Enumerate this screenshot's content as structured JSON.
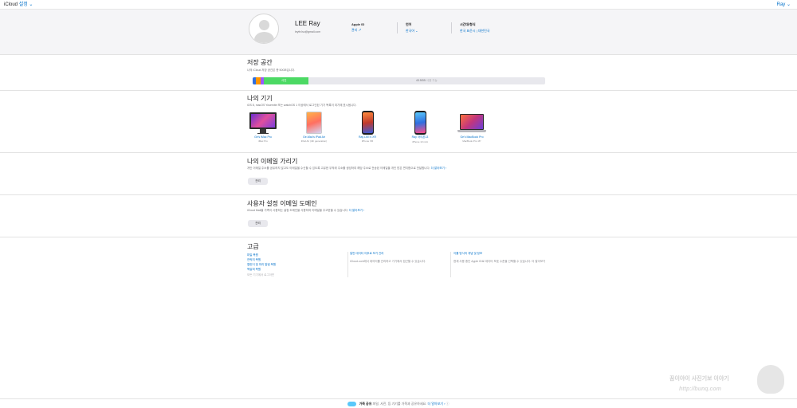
{
  "topbar": {
    "brand": "iCloud",
    "app_title": "설정",
    "user_menu": "Ray"
  },
  "profile": {
    "name": "LEE Ray",
    "email": "leyfe.lsc@gmail.com",
    "apple_id_label": "Apple ID",
    "apple_id_link": "관리",
    "language_label": "언어",
    "language_value": "한국어",
    "timezone_label": "시간대/형식",
    "timezone_value": "한국 표준시 | 대한민국"
  },
  "storage": {
    "title": "저장 공간",
    "subtitle": "나의 iCloud 저장 공간은 총 50GB입니다.",
    "photos_label": "사진",
    "free_label": "43.5GB",
    "free_suffix": "사용 가능",
    "usage": {
      "used_fraction": 0.19
    },
    "colors": {
      "segment1": "#2f6fe0",
      "segment2": "#ff9500",
      "segment3": "#9b59ff",
      "photos": "#4cd964",
      "free": "#e8e8ed"
    }
  },
  "devices": {
    "title": "나의 기기",
    "subtitle": "iOS 8, macOS Yosemite 또는 watchOS 1 이상에서 로그인된 기기 목록이 여기에 표시됩니다.",
    "items": [
      {
        "name": "Ge's iMac Pro",
        "model": "iMac Pro",
        "icon": "imac-icon"
      },
      {
        "name": "Ge-Mac's iPad Air",
        "model": "iPad Air (4th generation)",
        "icon": "ipad-icon"
      },
      {
        "name": "Ray LEE's XR",
        "model": "iPhone XR",
        "icon": "iphone-icon"
      },
      {
        "name": "Ray 아이폰13",
        "model": "iPhone 13 mini",
        "icon": "iphone-icon"
      },
      {
        "name": "Ge's MacBook Pro",
        "model": "MacBook Pro 16\"",
        "icon": "macbook-icon"
      }
    ]
  },
  "hide_email": {
    "title": "나의 이메일 가리기",
    "subtitle": "개인 이메일 주소를 공유하지 않고도 이메일을 수신할 수 있도록 고유한 무작위 주소를 생성하여 해당 주소로 전송된 이메일을 개인 받은 편지함으로 전달합니다.",
    "more_link": "더 알아보기 ›",
    "button": "관리"
  },
  "custom_domain": {
    "title": "사용자 설정 이메일 도메인",
    "subtitle": "iCloud Mail을 가족이 사용하는 설정 도메인을 사용하여 이메일을 주고받을 수 있습니다.",
    "more_link": "더 알아보기 ›",
    "button": "관리"
  },
  "advanced": {
    "title": "고급",
    "links": [
      "파일 복원",
      "연락처 복원",
      "캘린더 및 미리 알림 복원",
      "책갈피 복원"
    ],
    "link_note": "모든 기기에서 로그아웃",
    "col2_title": "일반 데이터 이후로 보기 관리",
    "col2_desc": "iCloud.com에서 데이터를 관리하고 기기에서 접근할 수 있습니다.",
    "col3_title": "이를 방식의 개념 및 정보",
    "col3_desc": "현재 사용 중인 Apple ID로 데이터 보호 수준을 선택할 수 있습니다. 더 알아보기"
  },
  "footer": {
    "label": "가족 공유",
    "text": "파일, 사진, 등 기기를 가족과 공유하세요.",
    "link": "더 알아보기 ›"
  },
  "watermark": {
    "line1": "꿈이야이 사진기보 이야기",
    "line2": "http://bunq.com"
  }
}
